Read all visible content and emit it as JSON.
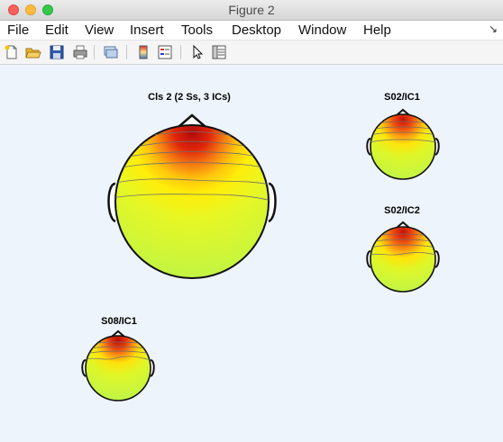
{
  "window": {
    "title": "Figure 2"
  },
  "menu": {
    "items": [
      "File",
      "Edit",
      "View",
      "Insert",
      "Tools",
      "Desktop",
      "Window",
      "Help"
    ],
    "overflow_arrow": "↘"
  },
  "toolbar": {
    "buttons": [
      "new-figure-icon",
      "open-file-icon",
      "save-icon",
      "print-icon",
      "link-icon",
      "colorbar-icon",
      "legend-icon",
      "pointer-icon",
      "property-inspector-icon"
    ]
  },
  "plots": [
    {
      "label": "Cls 2 (2 Ss, 3 ICs)"
    },
    {
      "label": "S02/IC1"
    },
    {
      "label": "S02/IC2"
    },
    {
      "label": "S08/IC1"
    }
  ],
  "colors": {
    "red": "#d11a08",
    "orange": "#f28a10",
    "yellow": "#ffe40a",
    "yellow_green": "#e2f527",
    "green": "#c4f53e",
    "outline": "#111111",
    "contour": "#6e6e6e"
  }
}
